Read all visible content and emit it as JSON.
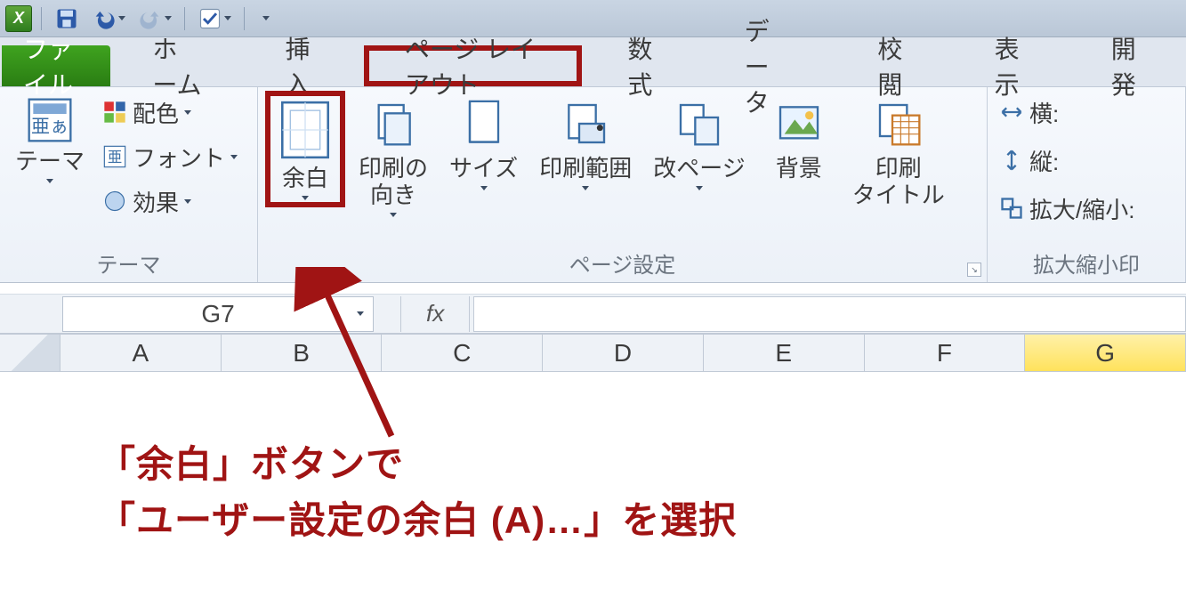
{
  "qat": {
    "app_letter": "X",
    "save_title": "保存",
    "undo_title": "元に戻す",
    "redo_title": "やり直し",
    "custom_title": "カスタマイズ"
  },
  "tabs": {
    "file": "ファイル",
    "home": "ホーム",
    "insert": "挿入",
    "page_layout": "ページ レイアウト",
    "formulas": "数式",
    "data": "データ",
    "review": "校閲",
    "view": "表示",
    "developer": "開発"
  },
  "ribbon": {
    "themes": {
      "themes": "テーマ",
      "colors": "配色",
      "fonts": "フォント",
      "effects": "効果",
      "group_label": "テーマ"
    },
    "page_setup": {
      "margins": "余白",
      "orientation": "印刷の\n向き",
      "size": "サイズ",
      "print_area": "印刷範囲",
      "breaks": "改ページ",
      "background": "背景",
      "print_titles": "印刷\nタイトル",
      "group_label": "ページ設定"
    },
    "scale": {
      "width": "横:",
      "height": "縦:",
      "scale": "拡大/縮小:",
      "group_label": "拡大縮小印"
    }
  },
  "namebox": {
    "value": "G7",
    "fx": "fx"
  },
  "columns": [
    "A",
    "B",
    "C",
    "D",
    "E",
    "F",
    "G"
  ],
  "active_col": "G",
  "annotation": {
    "line1": "「余白」ボタンで",
    "line2": "「ユーザー設定の余白 (A)…」を選択"
  }
}
